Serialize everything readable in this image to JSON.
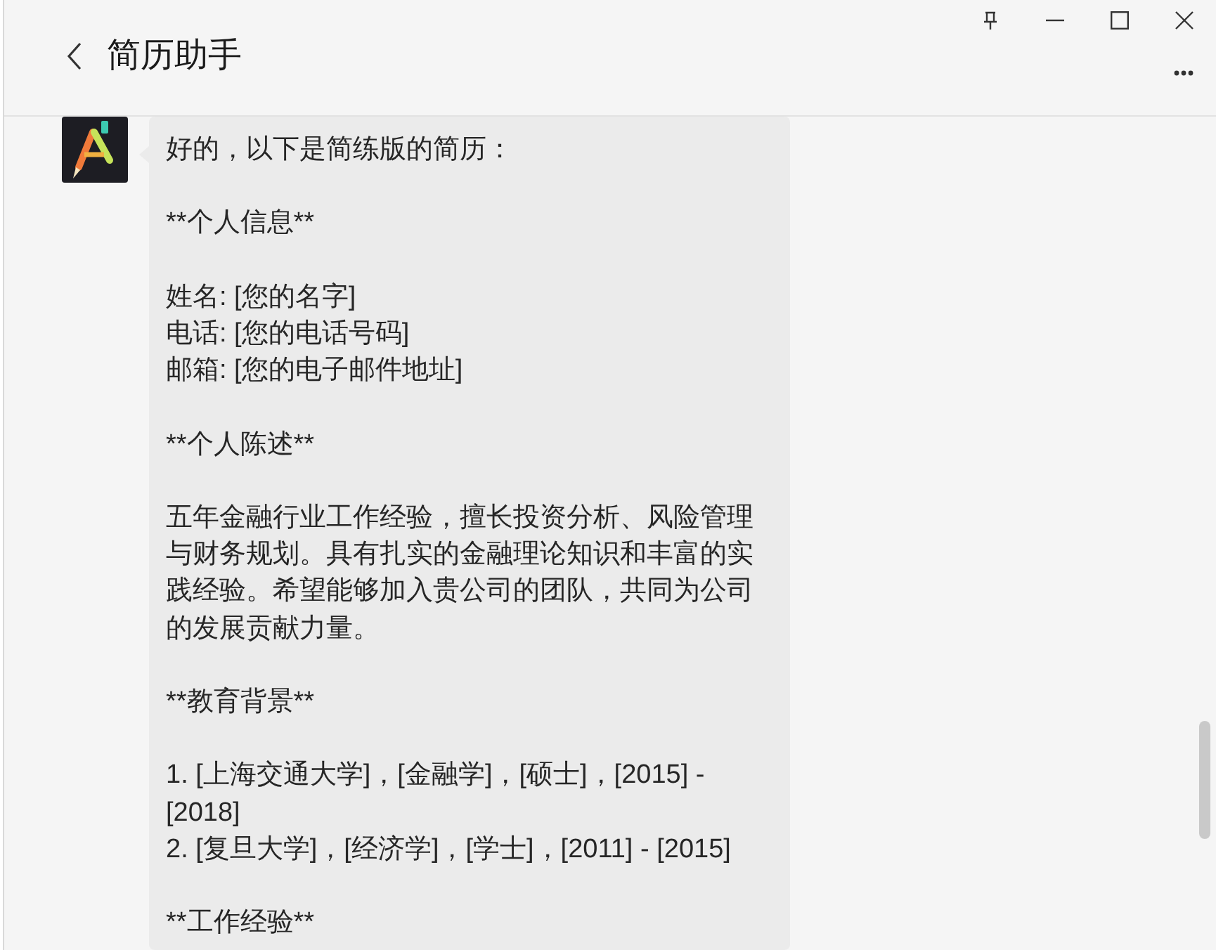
{
  "window": {
    "title": "简历助手"
  },
  "message": {
    "blocks": [
      [
        "好的，以下是简练版的简历："
      ],
      [
        "**个人信息**"
      ],
      [
        "姓名: [您的名字]",
        "电话: [您的电话号码]",
        "邮箱: [您的电子邮件地址]"
      ],
      [
        "**个人陈述**"
      ],
      [
        "五年金融行业工作经验，擅长投资分析、风险管理与财务规划。具有扎实的金融理论知识和丰富的实践经验。希望能够加入贵公司的团队，共同为公司的发展贡献力量。"
      ],
      [
        "**教育背景**"
      ],
      [
        "1. [上海交通大学]，[金融学]，[硕士]，[2015] - [2018]",
        "2. [复旦大学]，[经济学]，[学士]，[2011] - [2015]"
      ],
      [
        "**工作经验**"
      ]
    ]
  }
}
